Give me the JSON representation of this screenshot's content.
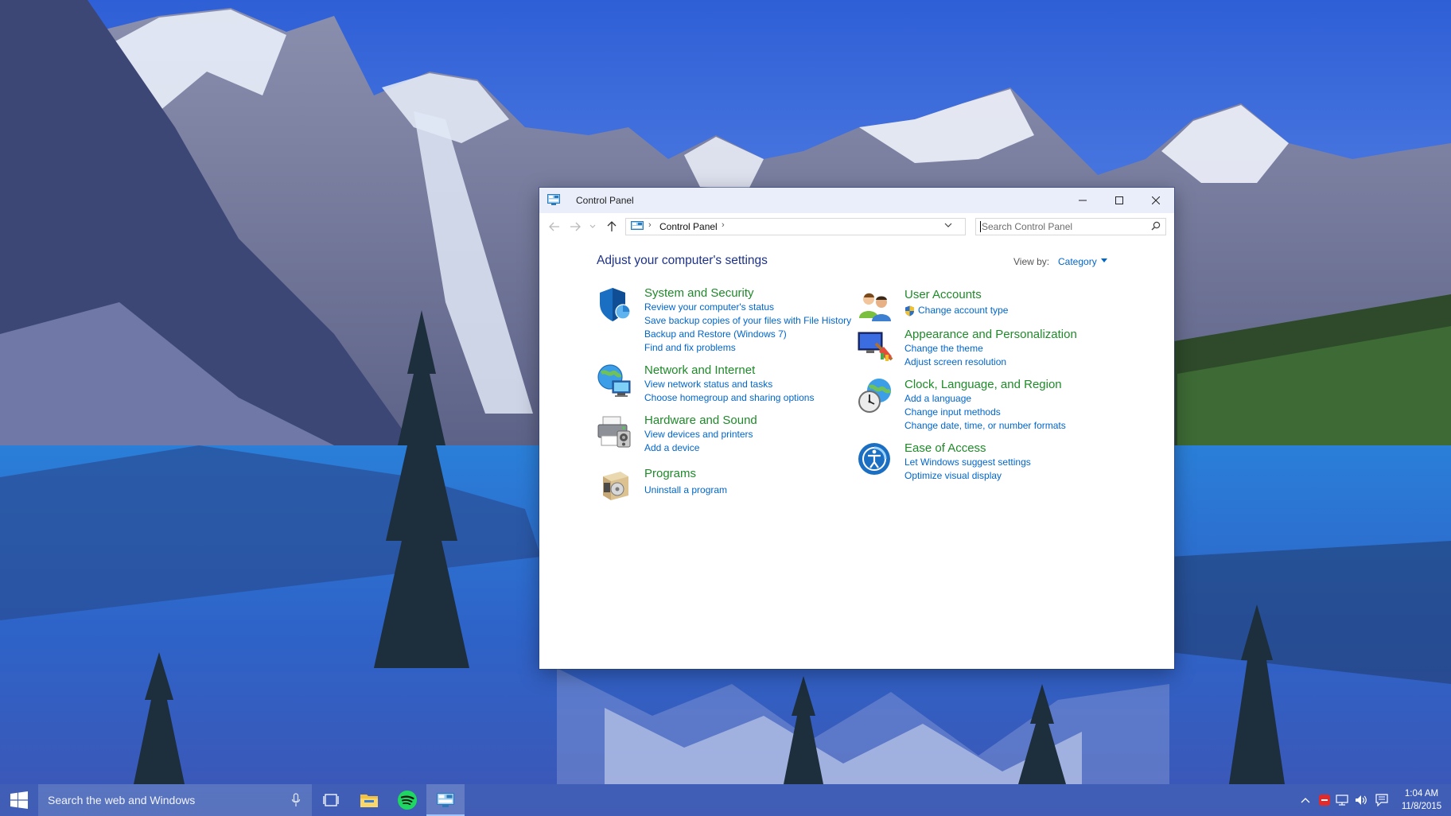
{
  "window": {
    "title": "Control Panel"
  },
  "address_bar": {
    "path": "Control Panel",
    "search_placeholder": "Search Control Panel"
  },
  "main": {
    "heading": "Adjust your computer's settings",
    "view_by_label": "View by:",
    "view_by_value": "Category"
  },
  "categories": [
    {
      "title": "System and Security",
      "links": [
        "Review your computer's status",
        "Save backup copies of your files with File History",
        "Backup and Restore (Windows 7)",
        "Find and fix problems"
      ]
    },
    {
      "title": "Network and Internet",
      "links": [
        "View network status and tasks",
        "Choose homegroup and sharing options"
      ]
    },
    {
      "title": "Hardware and Sound",
      "links": [
        "View devices and printers",
        "Add a device"
      ]
    },
    {
      "title": "Programs",
      "links": [
        "Uninstall a program"
      ]
    },
    {
      "title": "User Accounts",
      "links": [
        "Change account type"
      ]
    },
    {
      "title": "Appearance and Personalization",
      "links": [
        "Change the theme",
        "Adjust screen resolution"
      ]
    },
    {
      "title": "Clock, Language, and Region",
      "links": [
        "Add a language",
        "Change input methods",
        "Change date, time, or number formats"
      ]
    },
    {
      "title": "Ease of Access",
      "links": [
        "Let Windows suggest settings",
        "Optimize visual display"
      ]
    }
  ],
  "taskbar": {
    "search_text": "Search the web and Windows",
    "time": "1:04 AM",
    "date": "11/8/2015"
  },
  "colors": {
    "category_title": "#1f8a2a",
    "link": "#0066cc",
    "heading": "#1e3287"
  },
  "icons": [
    "windows-logo-icon",
    "microphone-icon",
    "task-view-icon",
    "file-explorer-icon",
    "spotify-icon",
    "control-panel-icon",
    "chevron-up-icon",
    "network-icon",
    "volume-icon",
    "action-center-icon",
    "search-icon",
    "refresh-icon",
    "up-arrow-icon",
    "back-arrow-icon",
    "forward-arrow-icon",
    "shield-icon"
  ]
}
